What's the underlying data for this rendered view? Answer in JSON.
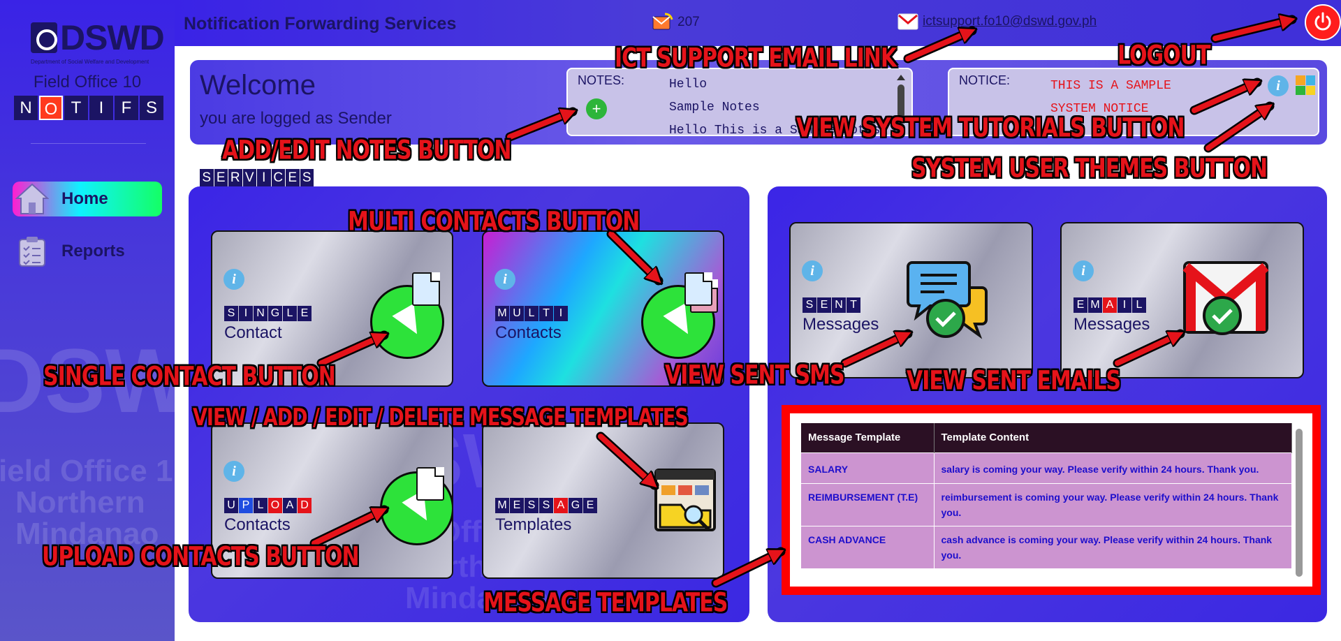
{
  "sidebar": {
    "logo_text": "DSWD",
    "logo_sub": "Department of Social Welfare and Development",
    "field_office": "Field Office 10",
    "brand_letters": [
      "N",
      "O",
      "T",
      "I",
      "F",
      "S"
    ],
    "brand_highlight_index": 1,
    "watermark": {
      "big": "DSWI",
      "line1": "ield Office 1",
      "line2": "Northern",
      "line3": "Mindanao"
    },
    "nav": [
      {
        "label": "Home",
        "icon": "home-icon",
        "active": true
      },
      {
        "label": "Reports",
        "icon": "clipboard-checklist-icon",
        "active": false
      }
    ]
  },
  "topbar": {
    "title": "Notification Forwarding Services",
    "phone_count": "207",
    "phone_icon": "phone-envelope-icon",
    "support_email": "ictsupport.fo10@dswd.gov.ph",
    "email_icon": "gmail-icon",
    "logout_icon": "power-icon"
  },
  "welcome": {
    "greeting": "Welcome",
    "role_text": "you are logged as Sender",
    "notes_label": "NOTES:",
    "notes_lines": [
      "Hello",
      "Sample Notes",
      "Hello This is a Sample Notes"
    ],
    "notice_label": "NOTICE:",
    "notice_lines": [
      "THIS IS A SAMPLE",
      "SYSTEM NOTICE"
    ],
    "info_glyph": "i",
    "add_glyph": "+"
  },
  "services": {
    "label_letters": [
      "S",
      "E",
      "R",
      "V",
      "I",
      "C",
      "E",
      "S"
    ],
    "cards": [
      {
        "id": "single",
        "tag": [
          "S",
          "I",
          "N",
          "G",
          "L",
          "E"
        ],
        "sub": "Contact"
      },
      {
        "id": "multi",
        "tag": [
          "M",
          "U",
          "L",
          "T",
          "I"
        ],
        "sub": "Contacts"
      },
      {
        "id": "upload",
        "tag": [
          "U",
          "P",
          "L",
          "O",
          "A",
          "D"
        ],
        "tag_colors": [
          "dark",
          "blue",
          "dark",
          "red",
          "dark",
          "red"
        ],
        "sub": "Contacts"
      },
      {
        "id": "message",
        "tag": [
          "M",
          "E",
          "S",
          "S",
          "A",
          "G",
          "E"
        ],
        "tag_colors": [
          "dark",
          "dark",
          "dark",
          "dark",
          "red",
          "dark",
          "dark"
        ],
        "sub": "Templates"
      },
      {
        "id": "sent",
        "tag": [
          "S",
          "E",
          "N",
          "T"
        ],
        "sub": "Messages"
      },
      {
        "id": "email",
        "tag": [
          "E",
          "M",
          "A",
          "I",
          "L"
        ],
        "tag_colors": [
          "dark",
          "dark",
          "red",
          "dark",
          "dark"
        ],
        "sub": "Messages"
      }
    ],
    "watermark": {
      "line1": "DSWD",
      "line2": "eld Office",
      "line3": "Northern",
      "line4": "Mindanao"
    }
  },
  "templates_table": {
    "columns": [
      "Message Template",
      "Template Content"
    ],
    "rows": [
      {
        "name": "SALARY",
        "content": "salary is coming your way. Please verify within 24 hours. Thank you."
      },
      {
        "name": "REIMBURSEMENT (T.E)",
        "content": "reimbursement is coming your way. Please verify within 24 hours. Thank you."
      },
      {
        "name": "CASH ADVANCE",
        "content": "cash advance is coming your way. Please verify within 24 hours. Thank you."
      }
    ]
  },
  "annotations": {
    "email_link": "ICT SUPPORT EMAIL  LINK",
    "logout": "LOGOUT",
    "add_notes": "ADD/EDIT NOTES BUTTON",
    "tutorials": "VIEW SYSTEM TUTORIALS BUTTON",
    "themes": "SYSTEM USER THEMES BUTTON",
    "multi": "MULTI CONTACTS BUTTON",
    "single": "SINGLE CONTACT BUTTON",
    "sent_sms": "VIEW SENT SMS",
    "sent_emails": "VIEW SENT EMAILS",
    "templates_crud": "VIEW / ADD / EDIT / DELETE MESSAGE TEMPLATES",
    "upload": "UPLOAD CONTACTS BUTTON",
    "message_templates": "MESSAGE TEMPLATES"
  },
  "colors": {
    "brand_blue": "#3a23e6",
    "brand_navy": "#1b1464",
    "annotation_red": "#e5131a",
    "success_green": "#2de23a",
    "table_highlight_red": "#ff0000"
  }
}
